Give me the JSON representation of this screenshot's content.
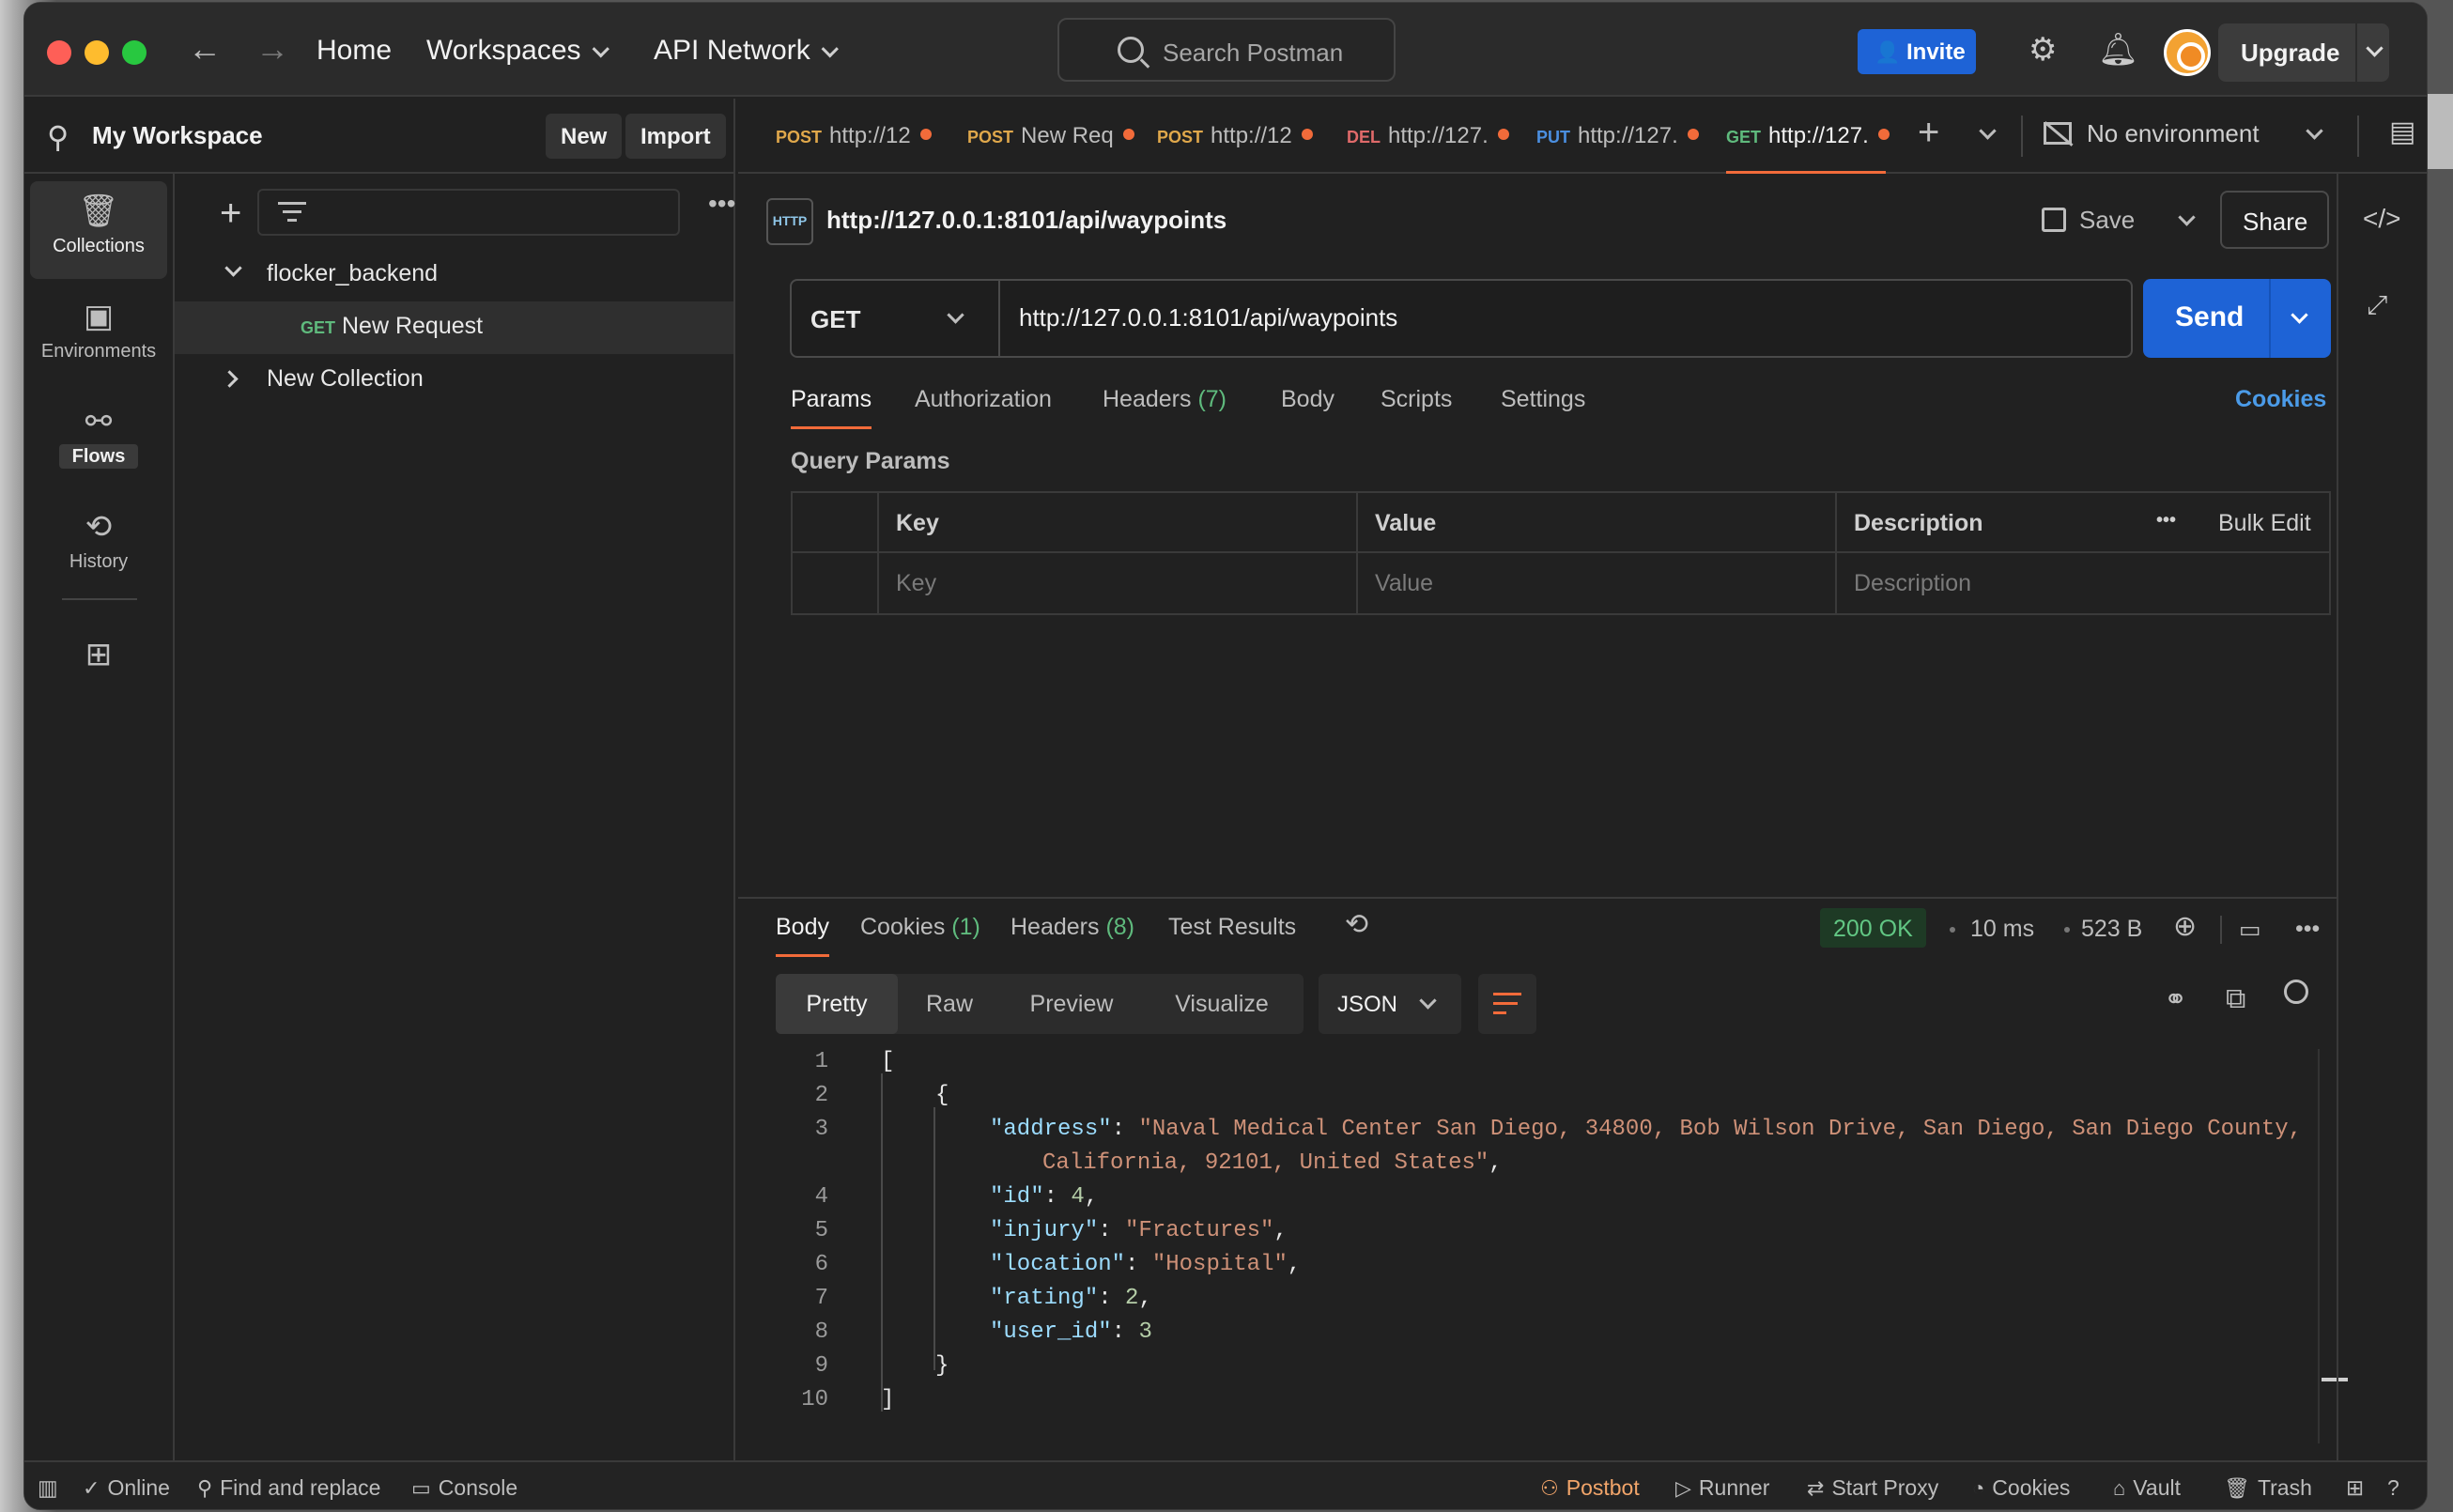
{
  "titlebar": {
    "nav": [
      "Home",
      "Workspaces",
      "API Network"
    ],
    "search_placeholder": "Search Postman",
    "invite_label": "Invite",
    "upgrade_label": "Upgrade"
  },
  "workspace": {
    "title": "My Workspace",
    "new_label": "New",
    "import_label": "Import"
  },
  "tabs": [
    {
      "method": "POST",
      "label": "http://12",
      "active": false
    },
    {
      "method": "POST",
      "label": "New Req",
      "active": false
    },
    {
      "method": "POST",
      "label": "http://12",
      "active": false
    },
    {
      "method": "DEL",
      "label": "http://127.",
      "active": false
    },
    {
      "method": "PUT",
      "label": "http://127.",
      "active": false
    },
    {
      "method": "GET",
      "label": "http://127.",
      "active": true
    }
  ],
  "environment": "No environment",
  "rail": [
    {
      "label": "Collections",
      "active": true
    },
    {
      "label": "Environments",
      "active": false
    },
    {
      "label": "Flows",
      "active": false
    },
    {
      "label": "History",
      "active": false
    }
  ],
  "sidebar": {
    "collections": [
      {
        "name": "flocker_backend",
        "expanded": true,
        "requests": [
          {
            "method": "GET",
            "name": "New Request"
          }
        ]
      },
      {
        "name": "New Collection",
        "expanded": false,
        "requests": []
      }
    ]
  },
  "request": {
    "title": "http://127.0.0.1:8101/api/waypoints",
    "save_label": "Save",
    "share_label": "Share",
    "method": "GET",
    "url": "http://127.0.0.1:8101/api/waypoints",
    "send_label": "Send",
    "tabs": [
      "Params",
      "Authorization",
      "Headers",
      "Body",
      "Scripts",
      "Settings"
    ],
    "headers_count": "(7)",
    "cookies_label": "Cookies",
    "query_params_title": "Query Params",
    "param_columns": [
      "Key",
      "Value",
      "Description"
    ],
    "bulk_edit_label": "Bulk Edit",
    "param_placeholders": [
      "Key",
      "Value",
      "Description"
    ]
  },
  "response": {
    "tabs": [
      "Body",
      "Cookies",
      "Headers",
      "Test Results"
    ],
    "cookies_count": "(1)",
    "headers_count": "(8)",
    "status": "200 OK",
    "time": "10 ms",
    "size": "523 B",
    "formats": [
      "Pretty",
      "Raw",
      "Preview",
      "Visualize"
    ],
    "language": "JSON",
    "line_numbers": [
      "1",
      "2",
      "3",
      "",
      "4",
      "5",
      "6",
      "7",
      "8",
      "9",
      "10"
    ],
    "body": {
      "address_value": "\"Naval Medical Center San Diego, 34800, Bob Wilson Drive, San Diego, San Diego County,",
      "address_cont": "California, 92101, United States\"",
      "id": "4",
      "injury": "\"Fractures\"",
      "location": "\"Hospital\"",
      "rating": "2",
      "user_id": "3"
    }
  },
  "statusbar": {
    "left": [
      "Online",
      "Find and replace",
      "Console"
    ],
    "right": [
      "Postbot",
      "Runner",
      "Start Proxy",
      "Cookies",
      "Vault",
      "Trash"
    ]
  },
  "colors": {
    "accent_orange": "#f26b3a",
    "primary_blue": "#1e63d6",
    "success_green": "#62c784"
  }
}
